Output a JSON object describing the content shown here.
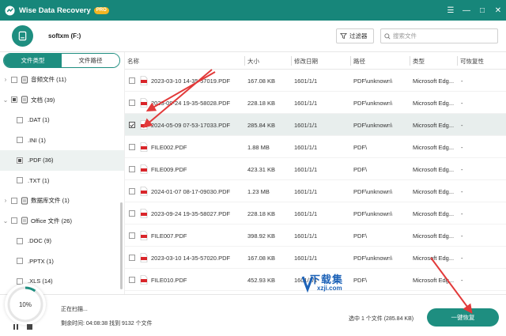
{
  "app": {
    "title": "Wise Data Recovery",
    "badge": "PRO",
    "window_controls": [
      "☰",
      "—",
      "□",
      "✕"
    ]
  },
  "header": {
    "drive_name": "softxm (F:)",
    "filter_label": "过滤器",
    "search_placeholder": "搜索文件"
  },
  "sidebar": {
    "tabs": [
      {
        "label": "文件类型",
        "active": true
      },
      {
        "label": "文件路径",
        "active": false
      }
    ],
    "tree": [
      {
        "label": "音频文件 (11)",
        "level": 0,
        "expandable": true,
        "check": "none",
        "icon": "audio-icon",
        "selected": false
      },
      {
        "label": "文档 (39)",
        "level": 0,
        "expandable": true,
        "expanded": true,
        "check": "partial",
        "icon": "document-icon",
        "selected": false
      },
      {
        "label": ".DAT (1)",
        "level": 1,
        "expandable": false,
        "check": "none",
        "icon": "file-icon",
        "selected": false
      },
      {
        "label": ".INI (1)",
        "level": 1,
        "expandable": false,
        "check": "none",
        "icon": "file-icon",
        "selected": false
      },
      {
        "label": ".PDF (36)",
        "level": 1,
        "expandable": false,
        "check": "partial",
        "icon": "file-icon",
        "selected": true
      },
      {
        "label": ".TXT (1)",
        "level": 1,
        "expandable": false,
        "check": "none",
        "icon": "file-icon",
        "selected": false
      },
      {
        "label": "数据库文件 (1)",
        "level": 0,
        "expandable": true,
        "check": "none",
        "icon": "database-icon",
        "selected": false
      },
      {
        "label": "Office 文件 (26)",
        "level": 0,
        "expandable": true,
        "expanded": true,
        "check": "none",
        "icon": "office-icon",
        "selected": false
      },
      {
        "label": ".DOC (9)",
        "level": 1,
        "expandable": false,
        "check": "none",
        "icon": "file-icon",
        "selected": false
      },
      {
        "label": ".PPTX (1)",
        "level": 1,
        "expandable": false,
        "check": "none",
        "icon": "file-icon",
        "selected": false
      },
      {
        "label": ".XLS (14)",
        "level": 1,
        "expandable": false,
        "check": "none",
        "icon": "file-icon",
        "selected": false
      }
    ]
  },
  "table": {
    "columns": [
      "名称",
      "大小",
      "修改日期",
      "路径",
      "类型",
      "可恢复性"
    ],
    "rows": [
      {
        "name": "2023-03-10 14-35-57019.PDF",
        "size": "167.08 KB",
        "date": "1601/1/1",
        "path": "PDF\\unknown\\",
        "type": "Microsoft Edg...",
        "recoverability": "-",
        "checked": false
      },
      {
        "name": "2023-09-24 19-35-58028.PDF",
        "size": "228.18 KB",
        "date": "1601/1/1",
        "path": "PDF\\unknown\\",
        "type": "Microsoft Edg...",
        "recoverability": "-",
        "checked": false
      },
      {
        "name": "2024-05-09 07-53-17033.PDF",
        "size": "285.84 KB",
        "date": "1601/1/1",
        "path": "PDF\\unknown\\",
        "type": "Microsoft Edg...",
        "recoverability": "-",
        "checked": true
      },
      {
        "name": "FILE002.PDF",
        "size": "1.88 MB",
        "date": "1601/1/1",
        "path": "PDF\\",
        "type": "Microsoft Edg...",
        "recoverability": "-",
        "checked": false
      },
      {
        "name": "FILE009.PDF",
        "size": "423.31 KB",
        "date": "1601/1/1",
        "path": "PDF\\",
        "type": "Microsoft Edg...",
        "recoverability": "-",
        "checked": false
      },
      {
        "name": "2024-01-07 08-17-09030.PDF",
        "size": "1.23 MB",
        "date": "1601/1/1",
        "path": "PDF\\unknown\\",
        "type": "Microsoft Edg...",
        "recoverability": "-",
        "checked": false
      },
      {
        "name": "2023-09-24 19-35-58027.PDF",
        "size": "228.18 KB",
        "date": "1601/1/1",
        "path": "PDF\\unknown\\",
        "type": "Microsoft Edg...",
        "recoverability": "-",
        "checked": false
      },
      {
        "name": "FILE007.PDF",
        "size": "398.92 KB",
        "date": "1601/1/1",
        "path": "PDF\\",
        "type": "Microsoft Edg...",
        "recoverability": "-",
        "checked": false
      },
      {
        "name": "2023-03-10 14-35-57020.PDF",
        "size": "167.08 KB",
        "date": "1601/1/1",
        "path": "PDF\\unknown\\",
        "type": "Microsoft Edg...",
        "recoverability": "-",
        "checked": false
      },
      {
        "name": "FILE010.PDF",
        "size": "452.93 KB",
        "date": "1601/1/1",
        "path": "PDF\\",
        "type": "Microsoft Edg...",
        "recoverability": "-",
        "checked": false
      }
    ]
  },
  "footer": {
    "progress": "10%",
    "progress_value": 0.1,
    "scan_status": "正在扫描...",
    "scan_stats": "剩余时间: 04:08:38  找到 9132 个文件",
    "selected_info": "选中 1 个文件 (285.84 KB)",
    "recover_label": "一键恢复"
  },
  "watermark": {
    "title": "下载集",
    "subtitle": "xzji.com"
  },
  "colors": {
    "accent": "#1e8e80",
    "titlebar": "#17867a",
    "pro_badge": "#f2b523",
    "arrow": "#e23a3a",
    "pdf_red": "#d9252a"
  }
}
